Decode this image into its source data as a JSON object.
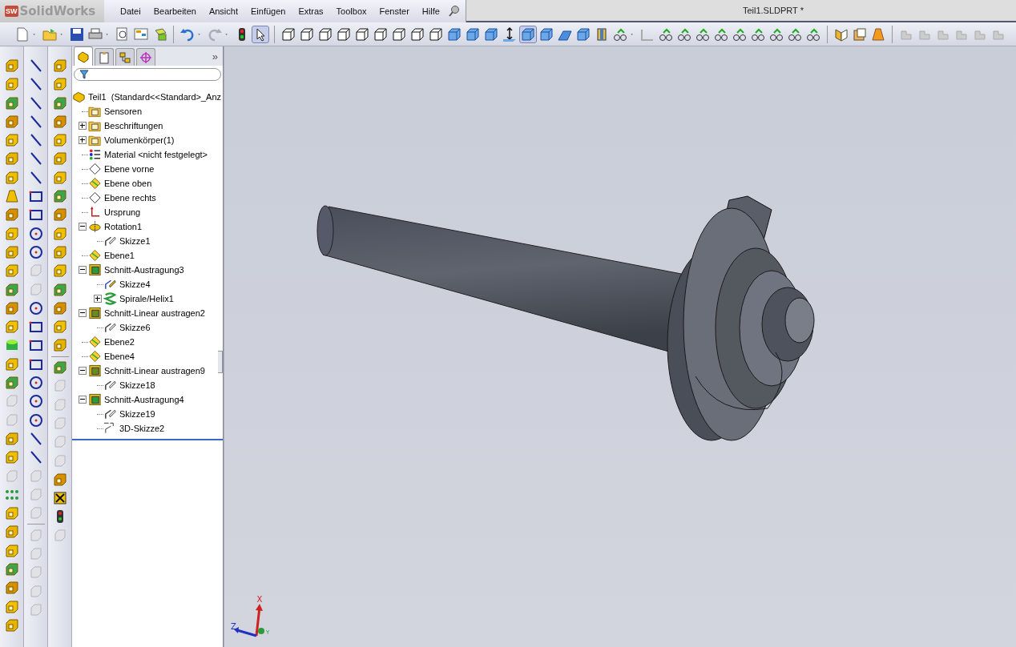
{
  "app": {
    "logo_badge": "SW",
    "logo": "SolidWorks"
  },
  "menu": [
    "Datei",
    "Bearbeiten",
    "Ansicht",
    "Einfügen",
    "Extras",
    "Toolbox",
    "Fenster",
    "Hilfe"
  ],
  "window": {
    "title": "Teil1.SLDPRT *"
  },
  "panel": {
    "tabs": [
      {
        "kind": "tree",
        "selected": true
      },
      {
        "kind": "property",
        "selected": false
      },
      {
        "kind": "config",
        "selected": false
      },
      {
        "kind": "display",
        "selected": false
      }
    ],
    "more": "»"
  },
  "tree": [
    {
      "label": "Teil1  (Standard<<Standard>_Anz",
      "kind": "part",
      "children": [
        {
          "label": "Sensoren",
          "kind": "sensor-folder"
        },
        {
          "label": "Beschriftungen",
          "kind": "annotation-folder",
          "expanded": false
        },
        {
          "label": "Volumenkörper(1)",
          "kind": "body-folder",
          "expanded": false
        },
        {
          "label": "Material <nicht festgelegt>",
          "kind": "material"
        },
        {
          "label": "Ebene vorne",
          "kind": "plane-outline"
        },
        {
          "label": "Ebene oben",
          "kind": "plane"
        },
        {
          "label": "Ebene rechts",
          "kind": "plane-outline"
        },
        {
          "label": "Ursprung",
          "kind": "origin"
        },
        {
          "label": "Rotation1",
          "kind": "revolve",
          "expanded": true,
          "children": [
            {
              "label": "Skizze1",
              "kind": "sketch"
            }
          ]
        },
        {
          "label": "Ebene1",
          "kind": "plane"
        },
        {
          "label": "Schnitt-Austragung3",
          "kind": "cut-sweep",
          "expanded": true,
          "children": [
            {
              "label": "Skizze4",
              "kind": "sketch-active"
            },
            {
              "label": "Spirale/Helix1",
              "kind": "helix",
              "expanded": false
            }
          ]
        },
        {
          "label": "Schnitt-Linear austragen2",
          "kind": "cut-extrude",
          "expanded": true,
          "children": [
            {
              "label": "Skizze6",
              "kind": "sketch"
            }
          ]
        },
        {
          "label": "Ebene2",
          "kind": "plane"
        },
        {
          "label": "Ebene4",
          "kind": "plane"
        },
        {
          "label": "Schnitt-Linear austragen9",
          "kind": "cut-extrude",
          "expanded": true,
          "children": [
            {
              "label": "Skizze18",
              "kind": "sketch"
            }
          ]
        },
        {
          "label": "Schnitt-Austragung4",
          "kind": "cut-sweep",
          "expanded": true,
          "children": [
            {
              "label": "Skizze19",
              "kind": "sketch"
            },
            {
              "label": "3D-Skizze2",
              "kind": "sketch3d"
            }
          ]
        }
      ]
    }
  ],
  "triad": {
    "x": "X",
    "z": "Z",
    "y": "Y"
  }
}
